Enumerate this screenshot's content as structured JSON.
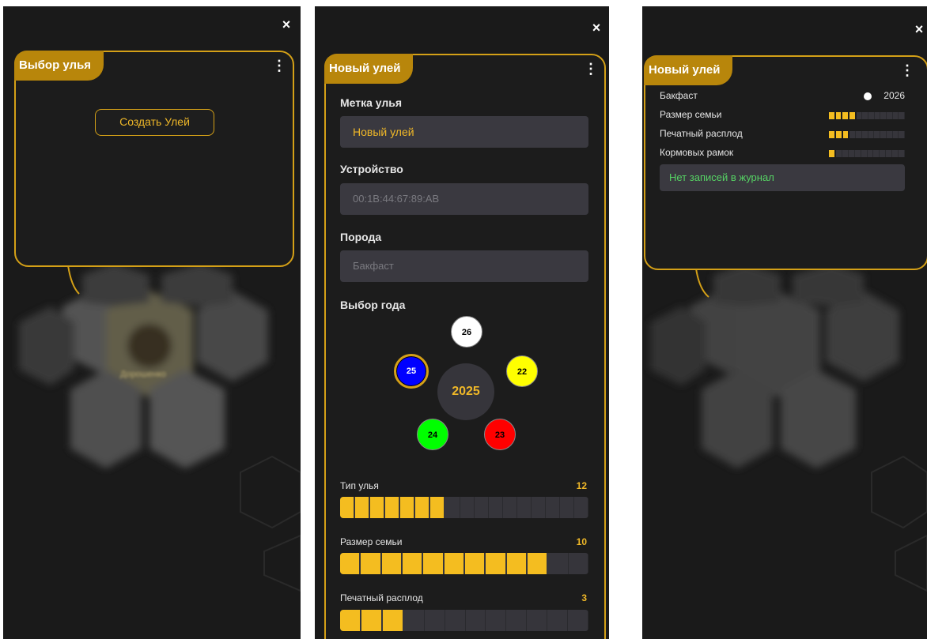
{
  "screen1": {
    "close_icon": "×",
    "panel_title": "Выбор улья",
    "menu_icon": "⋮",
    "create_button": "Создать Улей",
    "blurred_label": "Дорошенко"
  },
  "screen2": {
    "close_icon": "×",
    "panel_title": "Новый улей",
    "menu_icon": "⋮",
    "hive_label": "Метка улья",
    "hive_value": "Новый улей",
    "device_label": "Устройство",
    "device_placeholder": "00:1B:44:67:89:AB",
    "breed_label": "Порода",
    "breed_placeholder": "Бакфаст",
    "year_label": "Выбор года",
    "year_center": "2025",
    "years": [
      {
        "label": "26",
        "color": "#ffffff"
      },
      {
        "label": "22",
        "color": "#ffff00"
      },
      {
        "label": "23",
        "color": "#ff0000"
      },
      {
        "label": "24",
        "color": "#00ff00"
      },
      {
        "label": "25",
        "color": "#0000ff"
      }
    ],
    "sliders": [
      {
        "label": "Тип улья",
        "value": "12",
        "filled": 7,
        "total": 17
      },
      {
        "label": "Размер семьи",
        "value": "10",
        "filled": 10,
        "total": 12
      },
      {
        "label": "Печатный расплод",
        "value": "3",
        "filled": 3,
        "total": 12
      }
    ]
  },
  "screen3": {
    "close_icon": "×",
    "panel_title": "Новый улей",
    "menu_icon": "⋮",
    "breed": "Бакфаст",
    "year": "2026",
    "rows": [
      {
        "label": "Размер семьи",
        "filled": 4,
        "total": 12
      },
      {
        "label": "Печатный расплод",
        "filled": 3,
        "total": 12
      },
      {
        "label": "Кормовых рамок",
        "filled": 1,
        "total": 12
      }
    ],
    "journal_text": "Нет записей в журнал"
  },
  "colors": {
    "accent": "#d4a017",
    "tab_bg": "#b8860b",
    "segment_on": "#f4bd20",
    "journal_text": "#56d364"
  }
}
